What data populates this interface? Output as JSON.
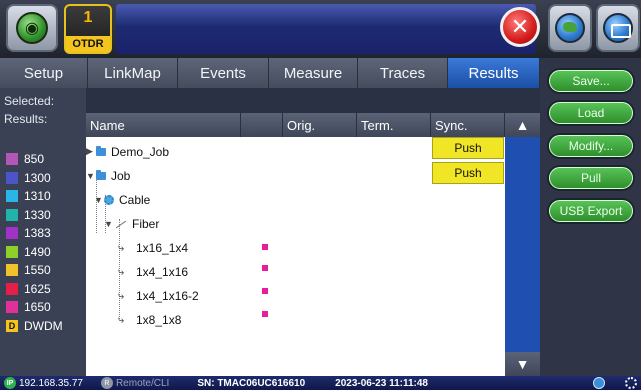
{
  "header": {
    "otdr_number": "1",
    "otdr_label": "OTDR",
    "close_symbol": "✕"
  },
  "tabs": [
    {
      "label": "Setup",
      "active": false
    },
    {
      "label": "LinkMap",
      "active": false
    },
    {
      "label": "Events",
      "active": false
    },
    {
      "label": "Measure",
      "active": false
    },
    {
      "label": "Traces",
      "active": false
    },
    {
      "label": "Results",
      "active": true
    }
  ],
  "left_panel": {
    "selected_label": "Selected:",
    "results_label": "Results:",
    "legend": [
      {
        "label": "850",
        "color": "#b456b8"
      },
      {
        "label": "1300",
        "color": "#4b55c8"
      },
      {
        "label": "1310",
        "color": "#29b6e6"
      },
      {
        "label": "1330",
        "color": "#21b4a8"
      },
      {
        "label": "1383",
        "color": "#a033c6"
      },
      {
        "label": "1490",
        "color": "#8fcf2a"
      },
      {
        "label": "1550",
        "color": "#f2c22a"
      },
      {
        "label": "1625",
        "color": "#e51e4a"
      },
      {
        "label": "1650",
        "color": "#e0319a"
      },
      {
        "label": "DWDM",
        "color": "#f4c51e",
        "badge": "D"
      }
    ]
  },
  "table": {
    "columns": [
      "Name",
      "",
      "Orig.",
      "Term.",
      "Sync."
    ],
    "rows": [
      {
        "name": "Demo_Job",
        "type": "folder",
        "expanded": false,
        "sync": "Push"
      },
      {
        "name": "Job",
        "type": "folder",
        "expanded": true,
        "sync": "Push"
      },
      {
        "name": "Cable",
        "type": "cable",
        "expanded": true,
        "sync": ""
      },
      {
        "name": "Fiber",
        "type": "fiber",
        "expanded": true,
        "sync": ""
      },
      {
        "name": "1x16_1x4",
        "type": "link",
        "orig_marker": true
      },
      {
        "name": "1x4_1x16",
        "type": "link",
        "orig_marker": true
      },
      {
        "name": "1x4_1x16-2",
        "type": "link",
        "orig_marker": true
      },
      {
        "name": "1x8_1x8",
        "type": "link",
        "orig_marker": true
      }
    ],
    "marker_color": "#e51ea0",
    "push_color": "#f1e626"
  },
  "scroll": {
    "up": "▲",
    "down": "▼"
  },
  "actions": [
    {
      "label": "Save..."
    },
    {
      "label": "Load"
    },
    {
      "label": "Modify..."
    },
    {
      "label": "Pull"
    },
    {
      "label": "USB Export"
    }
  ],
  "statusbar": {
    "ip_badge": "IP",
    "ip": "192.168.35.77",
    "remote_badge": "R",
    "remote": "Remote/CLI",
    "sn": "SN: TMAC06UC616610",
    "datetime": "2023-06-23  11:11:48"
  }
}
